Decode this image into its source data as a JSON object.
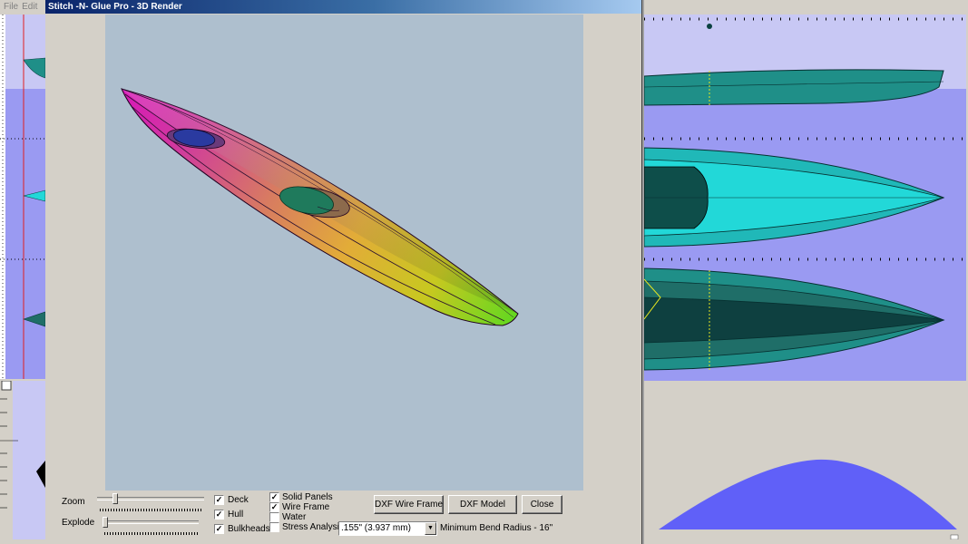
{
  "left_menu": {
    "file": "File",
    "edit": "Edit"
  },
  "dialog": {
    "title": "Stitch -N- Glue Pro - 3D Render",
    "zoom_label": "Zoom",
    "explode_label": "Explode",
    "zoom_level": 0.15,
    "explode_level": 0.0,
    "checkboxes": {
      "deck": {
        "label": "Deck",
        "checked": true
      },
      "hull": {
        "label": "Hull",
        "checked": true
      },
      "bulkheads": {
        "label": "Bulkheads",
        "checked": true
      },
      "solid_panels": {
        "label": "Solid Panels",
        "checked": true
      },
      "wire_frame": {
        "label": "Wire Frame",
        "checked": true
      },
      "water": {
        "label": "Water",
        "checked": false
      },
      "stress_analysis": {
        "label": "Stress Analysis",
        "checked": false
      }
    },
    "thickness_select": {
      "value": ".155\" (3.937 mm)"
    },
    "min_bend_radius": "Minimum Bend Radius - 16\"",
    "buttons": {
      "dxf_wire_frame": "DXF Wire Frame",
      "dxf_model": "DXF Model",
      "close": "Close"
    }
  },
  "colors": {
    "title_bar": "#0a246a",
    "viewport_bg": "#aebfce",
    "kayak_bow": "#e01ab4",
    "kayak_mid": "#e6a838",
    "kayak_stern": "#6ad620",
    "cockpit_front": "#2a3aa0",
    "cockpit_rear": "#1f7a5c",
    "side_view_bg": "#c8c8f4",
    "hull_teal": "#1f8f88",
    "deck_cyan": "#22d8d8",
    "curve_fill": "#6060f8"
  },
  "icons": {
    "select_arrow": "chevron-down-icon",
    "checkmark": "checkmark-icon"
  }
}
